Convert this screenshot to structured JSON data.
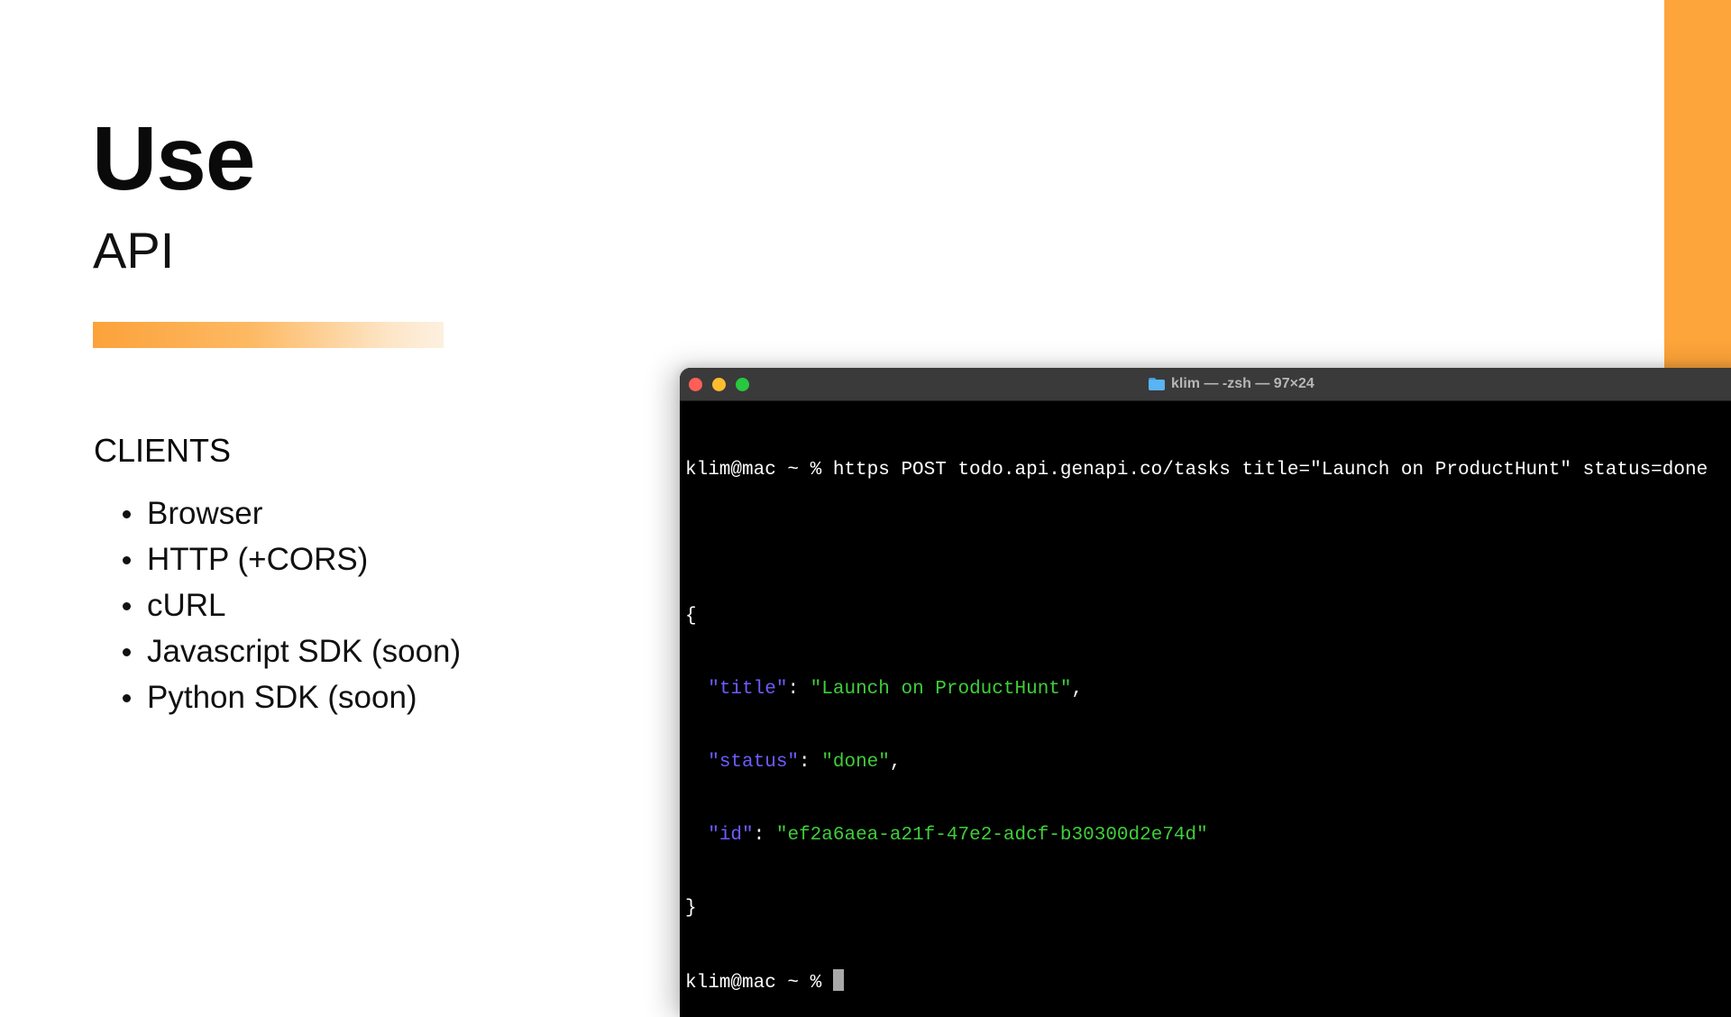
{
  "slide": {
    "title": "Use",
    "subtitle": "API",
    "clients_heading": "CLIENTS",
    "clients": [
      "Browser",
      "HTTP (+CORS)",
      "cURL",
      "Javascript SDK (soon)",
      "Python SDK (soon)"
    ]
  },
  "colors": {
    "accent": "#fda43a",
    "terminal_bg": "#000000",
    "json_key": "#6d5cff",
    "json_string": "#3fce3a"
  },
  "terminal": {
    "title": "klim — -zsh — 97×24",
    "title_icon": "folder-icon",
    "prompt": "klim@mac ~ % ",
    "command": "https POST todo.api.genapi.co/tasks title=\"Launch on ProductHunt\" status=done",
    "open_brace": "{",
    "close_brace": "}",
    "fields": [
      {
        "key": "\"title\"",
        "value": "\"Launch on ProductHunt\"",
        "trail": ","
      },
      {
        "key": "\"status\"",
        "value": "\"done\"",
        "trail": ","
      },
      {
        "key": "\"id\"",
        "value": "\"ef2a6aea-a21f-47e2-adcf-b30300d2e74d\"",
        "trail": ""
      }
    ],
    "final_prompt": "klim@mac ~ % "
  }
}
